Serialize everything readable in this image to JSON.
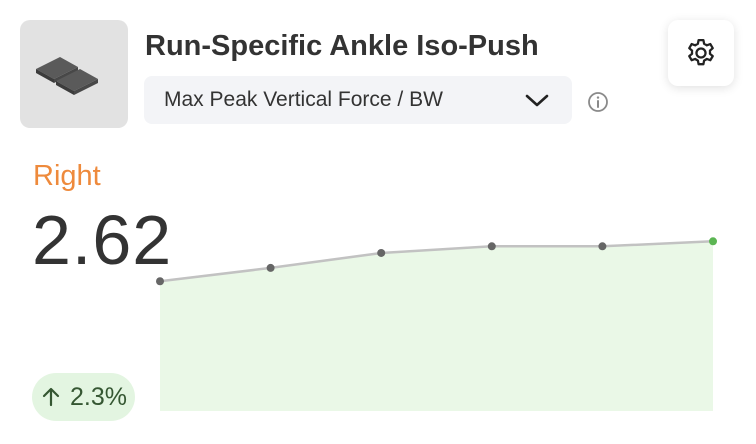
{
  "header": {
    "title": "Run-Specific Ankle Iso-Push",
    "thumbnail_icon": "force-plates-icon"
  },
  "metric_select": {
    "value": "Max Peak Vertical Force / BW"
  },
  "side": {
    "label": "Right",
    "color": "#ee8a3c"
  },
  "metric": {
    "value": "2.62"
  },
  "trend": {
    "direction": "up",
    "text": "2.3%",
    "color": "#355732",
    "background": "#e3f5e1"
  },
  "chart_data": {
    "type": "area",
    "values": [
      2.38,
      2.46,
      2.55,
      2.59,
      2.59,
      2.62
    ],
    "ylim": [
      1.6,
      2.7
    ],
    "line_color": "#c2c2c2",
    "point_color": "#666666",
    "last_point_color": "#5bb552",
    "fill_color": "#eaf8e7"
  }
}
